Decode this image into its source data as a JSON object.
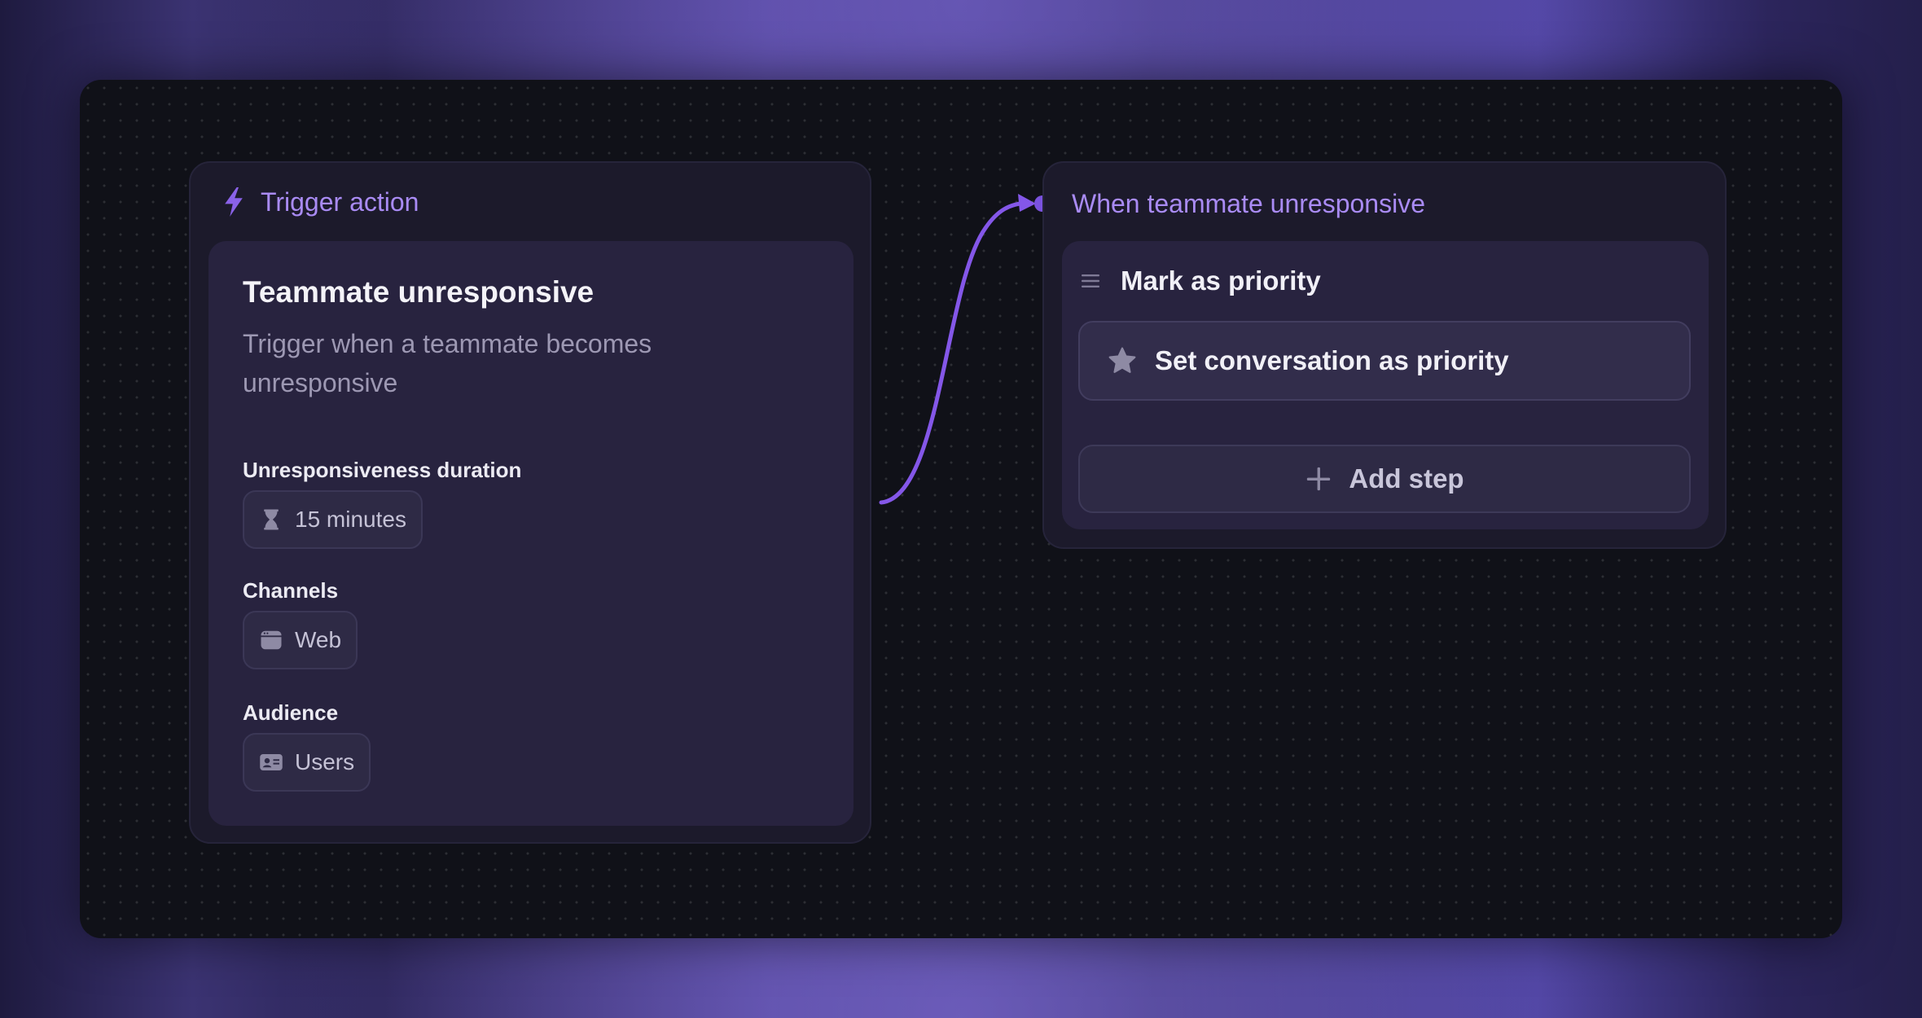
{
  "trigger_node": {
    "header": "Trigger action",
    "icon": "lightning-icon",
    "title": "Teammate unresponsive",
    "description": "Trigger when a teammate becomes unresponsive",
    "fields": [
      {
        "label": "Unresponsiveness duration",
        "value": "15 minutes",
        "icon": "hourglass-icon"
      },
      {
        "label": "Channels",
        "value": "Web",
        "icon": "browser-window-icon"
      },
      {
        "label": "Audience",
        "value": "Users",
        "icon": "id-card-icon"
      }
    ]
  },
  "action_node": {
    "header": "When teammate unresponsive",
    "step_title": "Mark as priority",
    "step_item": "Set conversation as priority",
    "step_item_icon": "star-icon",
    "add_step_label": "Add step"
  },
  "colors": {
    "accent": "#8b5cf6",
    "header_text": "#a98bf4",
    "canvas_bg": "#101118",
    "node_bg": "#1c1a2b",
    "card_bg": "#28233f"
  }
}
